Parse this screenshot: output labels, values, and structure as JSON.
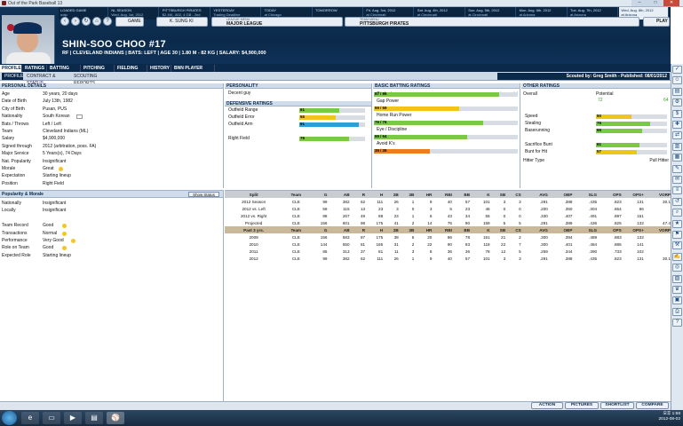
{
  "window": {
    "title": "Out of the Park Baseball 13"
  },
  "ticker": [
    {
      "a": "LOADED GAME",
      "b": "ootp"
    },
    {
      "a": "NL SEASON",
      "b": "Wed. Aug. 1st, 2012"
    },
    {
      "a": "PITTSBURGH PIRATES",
      "b": "$2.4M, .802, 4 GB - 2nd"
    },
    {
      "a": "YESTERDAY",
      "b": "Trading Deadline"
    },
    {
      "a": "TODAY",
      "b": "at Chicago"
    },
    {
      "a": "TOMORROW",
      "b": ""
    },
    {
      "a": "Fri. Aug. 3rd, 2012",
      "b": "at Cincinnati"
    },
    {
      "a": "Sat. Aug. 4th, 2012",
      "b": "at Cincinnati"
    },
    {
      "a": "Sun. Aug. 5th, 2012",
      "b": "at Cincinnati"
    },
    {
      "a": "Mon. Aug. 6th, 2012",
      "b": "at Arizona"
    },
    {
      "a": "Tue. Aug. 7th, 2012",
      "b": "at Arizona"
    },
    {
      "a": "Wed. Aug. 8th, 2012",
      "b": "at Arizona"
    }
  ],
  "nav": {
    "game": "GAME",
    "player_select": "K. SUNG KI",
    "league_label": "LEAGUE MENU",
    "league": "MAJOR LEAGUE",
    "team_label": "TEAM MENU",
    "team": "PITTSBURGH PIRATES",
    "play": "PLAY"
  },
  "player": {
    "name": "SHIN-SOO CHOO #17",
    "sub": "RF | CLEVELAND INDIANS | BATS: LEFT | AGE 30 | 1.80 M - 82 KG | SALARY: $4,900,000"
  },
  "tabs": [
    "PROFILE",
    "RATINGS",
    "BATTING STATS",
    "PITCHING STATS",
    "FIELDING STATS",
    "HISTORY",
    "BNN PLAYER PAGE"
  ],
  "subtabs": [
    "PROFILE",
    "CONTRACT & STATUS",
    "SCOUTING REPORTS"
  ],
  "scout": "Scouted by: Greg Smith - Published: 08/01/2012",
  "personal": {
    "title": "PERSONAL DETAILS",
    "rows": [
      [
        "Age",
        "30 years, 20 days"
      ],
      [
        "Date of Birth",
        "July 13th, 1982"
      ],
      [
        "City of Birth",
        "Pusan, PUS"
      ],
      [
        "Nationality",
        "South Korean"
      ],
      [
        "Bats / Throws",
        "Left / Left"
      ],
      [
        "Team",
        "Cleveland Indians (ML)"
      ],
      [
        "Salary",
        "$4,900,000"
      ],
      [
        "Signed through",
        "2012 (arbitration, poss. FA)"
      ],
      [
        "Major Service",
        "5 Years(s), 74 Days"
      ],
      [
        "Nat. Popularity",
        "Insignificant"
      ],
      [
        "Morale",
        "Great"
      ],
      [
        "Expectation",
        "Starting lineup"
      ],
      [
        "Position",
        "Right Field"
      ]
    ]
  },
  "personality": {
    "title": "PERSONALITY",
    "value": "Decent guy",
    "def_title": "DEFENSIVE RATINGS",
    "rows": [
      {
        "k": "Outfield Range",
        "v": "61",
        "pct": 0.61,
        "color": "#7ac943"
      },
      {
        "k": "Outfield Error",
        "v": "55",
        "pct": 0.55,
        "color": "#f0c419"
      },
      {
        "k": "Outfield Arm",
        "v": "91",
        "pct": 0.91,
        "color": "#2aa0d8"
      },
      {
        "k": "Right Field",
        "v": "76",
        "pct": 0.76,
        "color": "#7ac943"
      }
    ]
  },
  "batting": {
    "title": "BASIC BATTING RATINGS",
    "cp": "Current / Potential",
    "rows": [
      {
        "k": "Contact",
        "v": "87 / 86",
        "pct": 0.87,
        "color": "#7ac943"
      },
      {
        "k": "Gap Power",
        "v": "",
        "pct": 0,
        "color": "#7ac943"
      },
      {
        "k": "",
        "v": "59 / 59",
        "pct": 0.59,
        "color": "#f0c419"
      },
      {
        "k": "Home Run Power",
        "v": "",
        "pct": 0,
        "color": "#7ac943"
      },
      {
        "k": "",
        "v": "76 / 76",
        "pct": 0.76,
        "color": "#7ac943"
      },
      {
        "k": "Eye / Discipline",
        "v": "",
        "pct": 0,
        "color": "#7ac943"
      },
      {
        "k": "",
        "v": "65 / 64",
        "pct": 0.65,
        "color": "#7ac943"
      },
      {
        "k": "Avoid K's",
        "v": "",
        "pct": 0,
        "color": "#7ac943"
      },
      {
        "k": "",
        "v": "39 / 39",
        "pct": 0.39,
        "color": "#ef7d1a"
      }
    ]
  },
  "other": {
    "title": "OTHER RATINGS",
    "overall": "Overall",
    "potential": "Potential",
    "ov_val": "72",
    "pot_val": "64",
    "rows": [
      {
        "k": "Speed",
        "v": "50",
        "pct": 0.5,
        "color": "#f0c419"
      },
      {
        "k": "Stealing",
        "v": "76",
        "pct": 0.76,
        "color": "#7ac943"
      },
      {
        "k": "Baserunning",
        "v": "65",
        "pct": 0.65,
        "color": "#7ac943"
      },
      {
        "k": "Sacrifice Bunt",
        "v": "61",
        "pct": 0.61,
        "color": "#7ac943"
      },
      {
        "k": "Bunt for Hit",
        "v": "57",
        "pct": 0.57,
        "color": "#f0c419"
      }
    ],
    "hitter_type_label": "Hitter Type",
    "hitter_type": "Pull Hitter"
  },
  "popularity": {
    "title": "Popularity & Morale",
    "show_status": "Show Status",
    "rows": [
      [
        "Nationally",
        "Insignificant"
      ],
      [
        "Locally",
        "Insignificant"
      ],
      [
        "",
        ""
      ],
      [
        "Team Record",
        "Good"
      ],
      [
        "Transactions",
        "Normal"
      ],
      [
        "Performance",
        "Very Good"
      ],
      [
        "Role on Team",
        "Good"
      ],
      [
        "Expected Role",
        "Starting lineup"
      ]
    ]
  },
  "split_table": {
    "headers": [
      "Split",
      "Team",
      "G",
      "AB",
      "R",
      "H",
      "2B",
      "3B",
      "HR",
      "RBI",
      "BB",
      "K",
      "SB",
      "CS",
      "AVG",
      "OBP",
      "SLG",
      "OPS",
      "OPS+",
      "VORP"
    ],
    "rows": [
      [
        "2012 Season",
        "CLE",
        "99",
        "382",
        "62",
        "111",
        "26",
        "1",
        "9",
        "40",
        "57",
        "101",
        "3",
        "3",
        ".291",
        ".388",
        ".435",
        ".823",
        "131",
        "30.1"
      ],
      [
        "2012 vs. Left",
        "CLE",
        "59",
        "115",
        "13",
        "23",
        "3",
        "0",
        "3",
        "5",
        "23",
        "46",
        "0",
        "0",
        ".200",
        ".350",
        ".304",
        ".654",
        "86",
        ""
      ],
      [
        "2012 vs. Right",
        "CLE",
        "88",
        "267",
        "49",
        "88",
        "23",
        "1",
        "6",
        "43",
        "34",
        "55",
        "0",
        "0",
        ".330",
        ".407",
        ".491",
        ".897",
        "151",
        ""
      ],
      [
        "Projected",
        "CLE",
        "156",
        "601",
        "98",
        "175",
        "41",
        "2",
        "14",
        "75",
        "90",
        "159",
        "5",
        "5",
        ".291",
        ".389",
        ".436",
        ".825",
        "132",
        "47.4"
      ]
    ],
    "past_headers": [
      "Past 3 yrs.",
      "Team",
      "G",
      "AB",
      "R",
      "H",
      "2B",
      "3B",
      "HR",
      "RBI",
      "BB",
      "K",
      "SB",
      "CS",
      "AVG",
      "OBP",
      "SLG",
      "OPS",
      "OPS+",
      "VORP"
    ],
    "past": [
      [
        "2009",
        "CLE",
        "156",
        "583",
        "87",
        "175",
        "38",
        "6",
        "20",
        "86",
        "78",
        "151",
        "21",
        "2",
        ".300",
        ".394",
        ".489",
        ".883",
        "132",
        ""
      ],
      [
        "2010",
        "CLE",
        "144",
        "550",
        "81",
        "165",
        "31",
        "2",
        "22",
        "90",
        "83",
        "118",
        "22",
        "7",
        ".300",
        ".401",
        ".484",
        ".885",
        "141",
        ""
      ],
      [
        "2011",
        "CLE",
        "85",
        "313",
        "37",
        "81",
        "11",
        "3",
        "8",
        "36",
        "36",
        "78",
        "12",
        "5",
        ".259",
        ".344",
        ".390",
        ".733",
        "102",
        ""
      ],
      [
        "2012",
        "CLE",
        "99",
        "382",
        "62",
        "111",
        "26",
        "1",
        "9",
        "40",
        "57",
        "101",
        "3",
        "3",
        ".291",
        ".388",
        ".435",
        ".823",
        "131",
        "30.1"
      ]
    ]
  },
  "buttons": {
    "action": "ACTION",
    "pictures": "PICTURES",
    "shortlist": "SHORTLIST",
    "compare": "COMPARE"
  },
  "clock": {
    "time": "오후 1:58",
    "date": "2012-08-02"
  },
  "colors": {
    "navy": "#0b2a4b",
    "good": "#7ac943",
    "avg": "#f0c419",
    "poor": "#ef7d1a",
    "elite": "#2aa0d8"
  }
}
